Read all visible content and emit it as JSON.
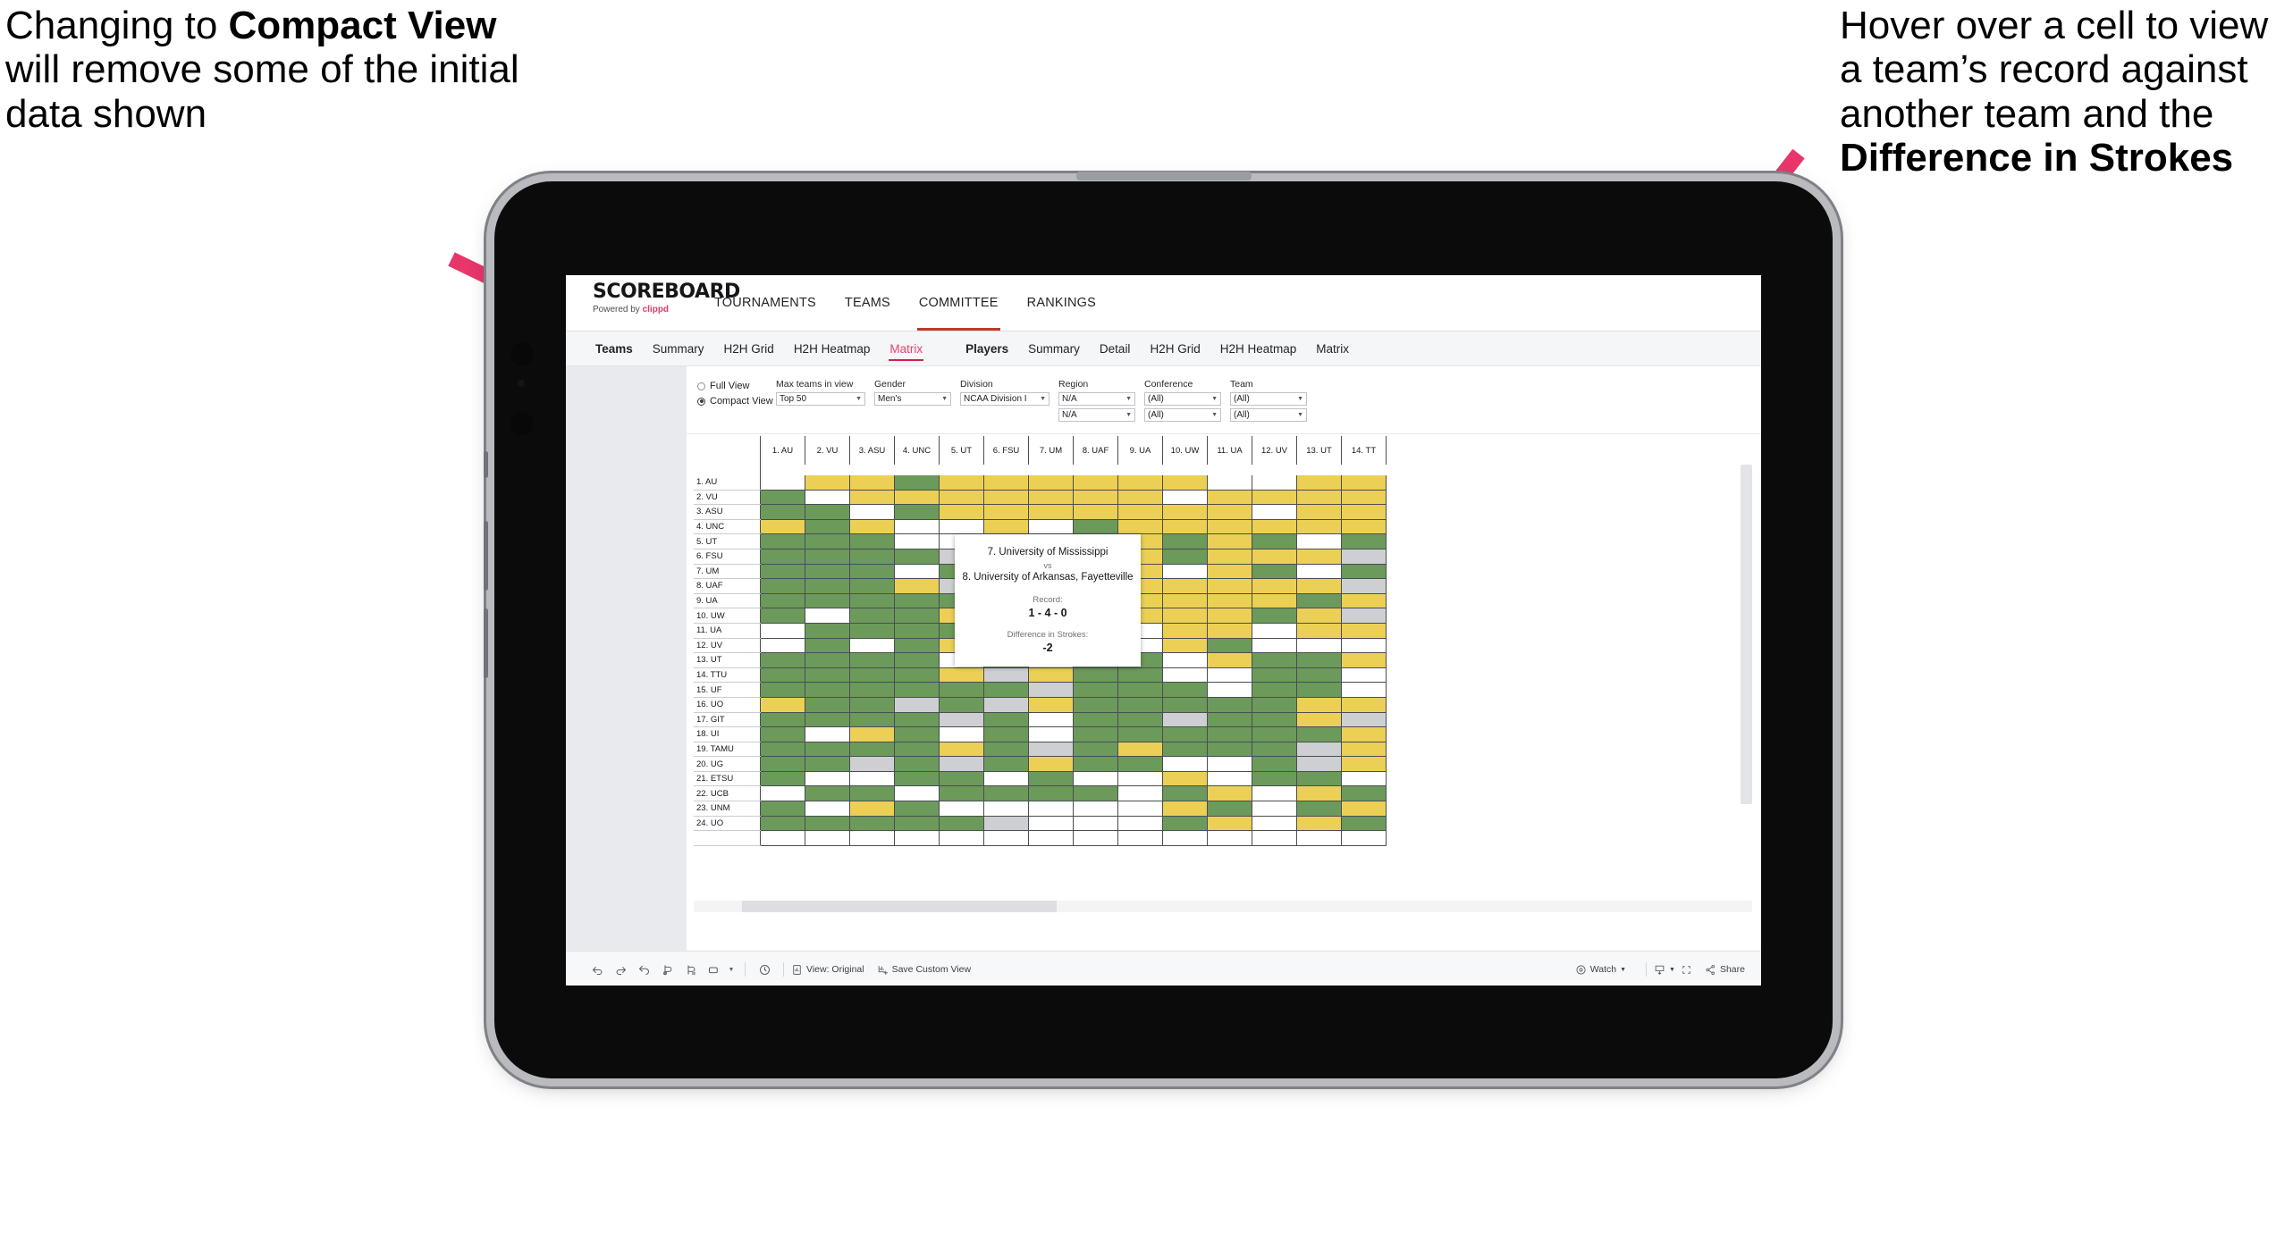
{
  "annotations": {
    "left_pre": "Changing to ",
    "left_bold": "Compact View",
    "left_post": " will remove some of the initial data shown",
    "right_pre": "Hover over a cell to view a team’s record against another team and the ",
    "right_bold": "Difference in Strokes",
    "accent_color": "#e8366b"
  },
  "app": {
    "brand": {
      "name": "SCOREBOARD",
      "powered_prefix": "Powered by ",
      "powered_by": "clippd"
    },
    "topnav": [
      {
        "label": "TOURNAMENTS",
        "active": false
      },
      {
        "label": "TEAMS",
        "active": false
      },
      {
        "label": "COMMITTEE",
        "active": true
      },
      {
        "label": "RANKINGS",
        "active": false
      }
    ],
    "subnav": [
      {
        "label": "Teams",
        "type": "header"
      },
      {
        "label": "Summary",
        "type": "tab"
      },
      {
        "label": "H2H Grid",
        "type": "tab"
      },
      {
        "label": "H2H Heatmap",
        "type": "tab"
      },
      {
        "label": "Matrix",
        "type": "tab",
        "selected": true
      },
      {
        "label": "Players",
        "type": "header"
      },
      {
        "label": "Summary",
        "type": "tab"
      },
      {
        "label": "Detail",
        "type": "tab"
      },
      {
        "label": "H2H Grid",
        "type": "tab"
      },
      {
        "label": "H2H Heatmap",
        "type": "tab"
      },
      {
        "label": "Matrix",
        "type": "tab"
      }
    ],
    "filters": {
      "view_mode": {
        "options": [
          "Full View",
          "Compact View"
        ],
        "selected": "Compact View"
      },
      "controls": [
        {
          "label": "Max teams in view",
          "values": [
            "Top 50"
          ]
        },
        {
          "label": "Gender",
          "values": [
            "Men's"
          ]
        },
        {
          "label": "Division",
          "values": [
            "NCAA Division I"
          ]
        },
        {
          "label": "Region",
          "values": [
            "N/A",
            "N/A"
          ]
        },
        {
          "label": "Conference",
          "values": [
            "(All)",
            "(All)"
          ]
        },
        {
          "label": "Team",
          "values": [
            "(All)",
            "(All)"
          ]
        }
      ]
    },
    "matrix": {
      "col_headers": [
        "1. AU",
        "2. VU",
        "3. ASU",
        "4. UNC",
        "5. UT",
        "6. FSU",
        "7. UM",
        "8. UAF",
        "9. UA",
        "10. UW",
        "11. UA",
        "12. UV",
        "13. UT",
        "14. TT"
      ],
      "row_headers": [
        "1. AU",
        "2. VU",
        "3. ASU",
        "4. UNC",
        "5. UT",
        "6. FSU",
        "7. UM",
        "8. UAF",
        "9. UA",
        "10. UW",
        "11. UA",
        "12. UV",
        "13. UT",
        "14. TTU",
        "15. UF",
        "16. UO",
        "17. GIT",
        "18. UI",
        "19. TAMU",
        "20. UG",
        "21. ETSU",
        "22. UCB",
        "23. UNM",
        "24. UO"
      ],
      "legend_colors": {
        "win": "#6b9a5b",
        "loss": "#ecd055",
        "tie": "#cdcfd2",
        "none": "#ffffff"
      },
      "cells": [
        [
          "n",
          "y",
          "y",
          "g",
          "y",
          "y",
          "y",
          "y",
          "y",
          "y",
          "w",
          "w",
          "y",
          "y"
        ],
        [
          "g",
          "n",
          "y",
          "y",
          "y",
          "y",
          "y",
          "y",
          "y",
          "w",
          "y",
          "y",
          "y",
          "y"
        ],
        [
          "g",
          "g",
          "n",
          "g",
          "y",
          "y",
          "y",
          "y",
          "y",
          "y",
          "y",
          "w",
          "y",
          "y"
        ],
        [
          "y",
          "g",
          "y",
          "n",
          "w",
          "y",
          "w",
          "g",
          "y",
          "y",
          "y",
          "y",
          "y",
          "y"
        ],
        [
          "g",
          "g",
          "g",
          "w",
          "w",
          "a",
          "y",
          "a",
          "y",
          "g",
          "y",
          "g",
          "w",
          "g"
        ],
        [
          "g",
          "g",
          "g",
          "g",
          "a",
          "w",
          "g",
          "y",
          "y",
          "g",
          "y",
          "y",
          "y",
          "a"
        ],
        [
          "g",
          "g",
          "g",
          "w",
          "g",
          "y",
          "w",
          "g",
          "y",
          "w",
          "y",
          "g",
          "w",
          "g"
        ],
        [
          "g",
          "g",
          "g",
          "y",
          "a",
          "g",
          "y",
          "w",
          "y",
          "y",
          "y",
          "y",
          "y",
          "a"
        ],
        [
          "g",
          "g",
          "g",
          "g",
          "g",
          "g",
          "g",
          "y",
          "y",
          "y",
          "y",
          "y",
          "g",
          "y"
        ],
        [
          "g",
          "w",
          "g",
          "g",
          "y",
          "y",
          "w",
          "y",
          "y",
          "y",
          "y",
          "g",
          "y",
          "a"
        ],
        [
          "w",
          "g",
          "g",
          "g",
          "g",
          "g",
          "g",
          "y",
          "w",
          "y",
          "y",
          "w",
          "y",
          "y"
        ],
        [
          "w",
          "g",
          "w",
          "g",
          "y",
          "g",
          "y",
          "y",
          "w",
          "y",
          "g",
          "w",
          "w",
          "w"
        ],
        [
          "g",
          "g",
          "g",
          "g",
          "w",
          "g",
          "w",
          "g",
          "g",
          "w",
          "y",
          "g",
          "g",
          "y"
        ],
        [
          "g",
          "g",
          "g",
          "g",
          "y",
          "a",
          "y",
          "g",
          "g",
          "w",
          "w",
          "g",
          "g",
          "w"
        ],
        [
          "g",
          "g",
          "g",
          "g",
          "g",
          "g",
          "a",
          "g",
          "g",
          "g",
          "w",
          "g",
          "g",
          "w"
        ],
        [
          "y",
          "g",
          "g",
          "a",
          "g",
          "a",
          "y",
          "g",
          "g",
          "g",
          "g",
          "g",
          "y",
          "y"
        ],
        [
          "g",
          "g",
          "g",
          "g",
          "a",
          "g",
          "w",
          "g",
          "g",
          "a",
          "g",
          "g",
          "y",
          "a"
        ],
        [
          "g",
          "w",
          "y",
          "g",
          "w",
          "g",
          "w",
          "g",
          "g",
          "g",
          "g",
          "g",
          "g",
          "y"
        ],
        [
          "g",
          "g",
          "g",
          "g",
          "y",
          "g",
          "a",
          "g",
          "y",
          "g",
          "g",
          "g",
          "a",
          "y"
        ],
        [
          "g",
          "g",
          "a",
          "g",
          "a",
          "g",
          "y",
          "g",
          "g",
          "w",
          "w",
          "g",
          "a",
          "y"
        ],
        [
          "g",
          "w",
          "w",
          "g",
          "g",
          "w",
          "g",
          "w",
          "w",
          "y",
          "w",
          "g",
          "g",
          "w"
        ],
        [
          "w",
          "g",
          "g",
          "w",
          "g",
          "g",
          "g",
          "g",
          "w",
          "g",
          "y",
          "w",
          "y",
          "g"
        ],
        [
          "g",
          "w",
          "y",
          "g",
          "w",
          "w",
          "w",
          "w",
          "w",
          "y",
          "g",
          "w",
          "g",
          "y"
        ],
        [
          "g",
          "g",
          "g",
          "g",
          "g",
          "a",
          "w",
          "w",
          "w",
          "g",
          "y",
          "w",
          "y",
          "g"
        ]
      ]
    },
    "tooltip": {
      "team_a": "7. University of Mississippi",
      "vs": "vs",
      "team_b": "8. University of Arkansas, Fayetteville",
      "record_label": "Record:",
      "record_value": "1 - 4 - 0",
      "diff_label": "Difference in Strokes:",
      "diff_value": "-2"
    },
    "toolbar": {
      "icons": [
        "undo-icon",
        "redo-icon",
        "revert-icon",
        "refresh-icon",
        "pause-icon",
        "resize-icon",
        "resize-caret-icon"
      ],
      "clock_icon": "clock-icon",
      "view_original_label": "View: Original",
      "save_custom_view_label": "Save Custom View",
      "watch_label": "Watch",
      "download_icon": "download-icon",
      "fullscreen_icon": "fullscreen-icon",
      "share_label": "Share"
    }
  }
}
